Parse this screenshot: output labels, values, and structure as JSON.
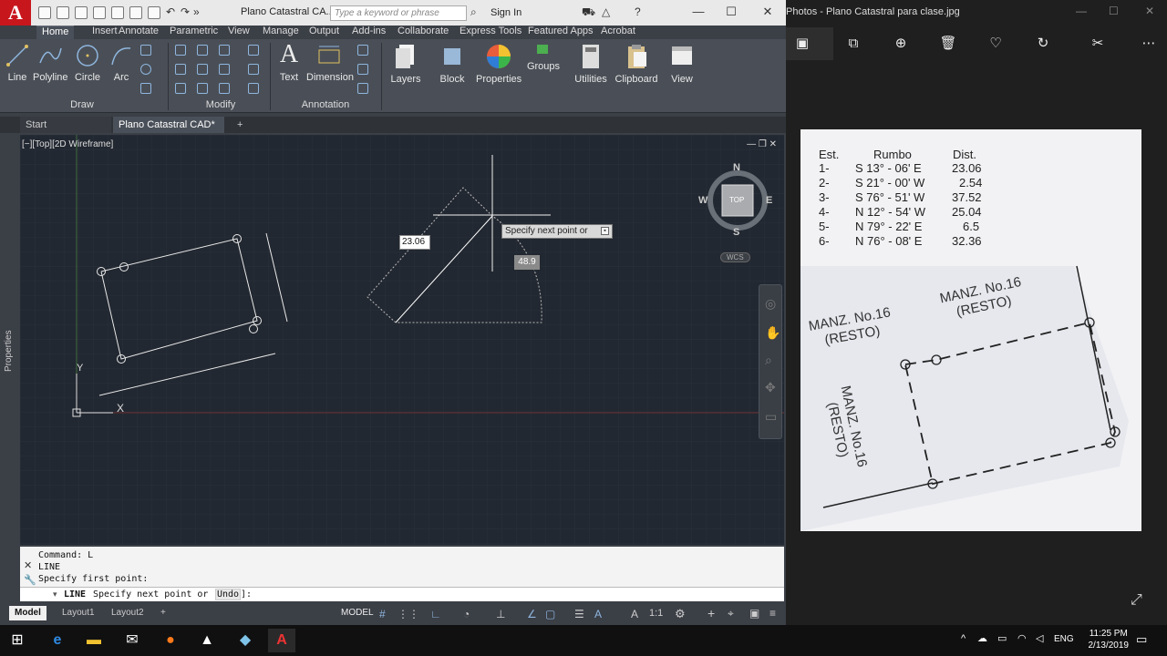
{
  "acad": {
    "app_letter": "A",
    "doc_title": "Plano Catastral CA...",
    "search_placeholder": "Type a keyword or phrase",
    "signin": "Sign In",
    "ribbon_tabs": [
      "Home",
      "Insert",
      "Annotate",
      "Parametric",
      "View",
      "Manage",
      "Output",
      "Add-ins",
      "Collaborate",
      "Express Tools",
      "Featured Apps",
      "Acrobat"
    ],
    "draw_tools": [
      "Line",
      "Polyline",
      "Circle",
      "Arc"
    ],
    "annotation_tools": [
      "Text",
      "Dimension"
    ],
    "big_tools": [
      "Layers",
      "Block",
      "Properties",
      "Groups",
      "Utilities",
      "Clipboard",
      "View"
    ],
    "panels": {
      "draw": "Draw",
      "modify": "Modify",
      "annotation": "Annotation"
    },
    "file_tabs": [
      "Start",
      "Plano Catastral CAD*"
    ],
    "properties_label": "Properties",
    "viewport_label": "[−][Top][2D Wireframe]",
    "viewcube": {
      "n": "N",
      "s": "S",
      "e": "E",
      "w": "W",
      "top": "TOP",
      "wcs": "WCS"
    },
    "dyn_input_value": "23.06",
    "dyn_prompt": "Specify next point or",
    "angle_value": "48.9",
    "ucs": {
      "x": "X",
      "y": "Y"
    },
    "command_history": [
      "Command: L",
      "LINE",
      "Specify first point:"
    ],
    "command_prompt_keyword": "LINE",
    "command_prompt_text": "Specify next point or [",
    "command_prompt_option": "Undo",
    "command_prompt_end": "]:",
    "layout_tabs": [
      "Model",
      "Layout1",
      "Layout2"
    ],
    "status_model": "MODEL",
    "status_scale": "1:1"
  },
  "photos": {
    "title": "Photos - Plano Catastral para clase.jpg",
    "table_headers": [
      "Est.",
      "Rumbo",
      "Dist."
    ],
    "table_rows": [
      {
        "est": "1-",
        "rumbo": "S 13° - 06' E",
        "dist": "23.06"
      },
      {
        "est": "2-",
        "rumbo": "S 21° - 00' W",
        "dist": "2.54"
      },
      {
        "est": "3-",
        "rumbo": "S 76° - 51' W",
        "dist": "37.52"
      },
      {
        "est": "4-",
        "rumbo": "N 12° - 54' W",
        "dist": "25.04"
      },
      {
        "est": "5-",
        "rumbo": "N 79° - 22' E",
        "dist": "6.5"
      },
      {
        "est": "6-",
        "rumbo": "N 76° - 08' E",
        "dist": "32.36"
      }
    ],
    "plan_labels": {
      "label_a_1": "MANZ. No.16",
      "label_a_2": "(RESTO)",
      "label_b_1": "MANZ. No.16",
      "label_b_2": "(RESTO)",
      "label_c_1": "MANZ. No.16",
      "label_c_2": "(RESTO)"
    }
  },
  "taskbar": {
    "time": "11:25 PM",
    "date": "2/13/2019",
    "lang": "ENG"
  }
}
